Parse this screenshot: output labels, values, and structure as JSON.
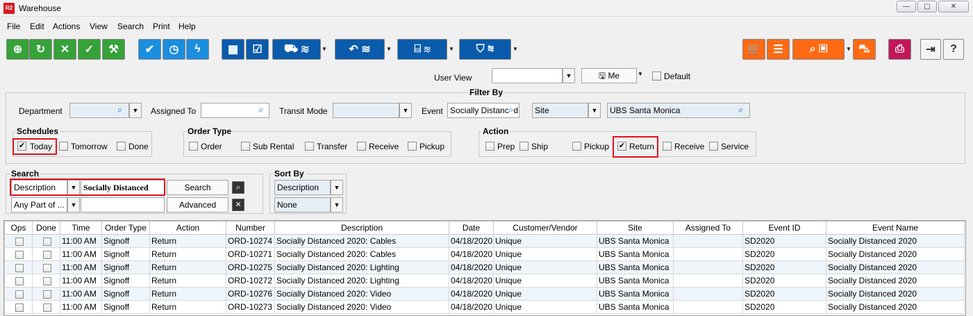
{
  "window": {
    "title": "Warehouse",
    "logo": "R2"
  },
  "menu": [
    "File",
    "Edit",
    "Actions",
    "View",
    "Search",
    "Print",
    "Help"
  ],
  "toolbar_icons": {
    "group1": [
      "add-document-icon",
      "refresh-icon",
      "close-icon",
      "checkmark-icon",
      "hand-truck-icon"
    ],
    "group2": [
      "check-circle-icon",
      "clock-icon",
      "lightning-icon"
    ],
    "group3": [
      "calendar-edit-icon",
      "checkbox-icon",
      "truck-stack-icon",
      "return-stack-icon",
      "door-stack-icon",
      "bucket-stack-icon"
    ],
    "group4": [
      "cart-icon",
      "user-report-icon",
      "search-box-icon",
      "vehicle-icon",
      "printer-icon",
      "exit-icon"
    ],
    "help_label": "?"
  },
  "user_view": {
    "label": "User View",
    "value": "",
    "me_label": "Me",
    "default_label": "Default"
  },
  "filter": {
    "title": "Filter By",
    "department_label": "Department",
    "department_value": "",
    "assigned_to_label": "Assigned To",
    "assigned_to_value": "",
    "transit_mode_label": "Transit Mode",
    "transit_mode_value": "",
    "event_label": "Event",
    "event_value": "Socially Distanced",
    "site_select": "Site",
    "site_value": "UBS Santa Monica"
  },
  "schedules": {
    "title": "Schedules",
    "today": "Today",
    "tomorrow": "Tomorrow",
    "done": "Done",
    "today_checked": true
  },
  "order_type": {
    "title": "Order Type",
    "items": [
      "Order",
      "Sub Rental",
      "Transfer",
      "Receive",
      "Pickup"
    ]
  },
  "action": {
    "title": "Action",
    "prep": "Prep",
    "ship": "Ship",
    "pickup": "Pickup",
    "return": "Return",
    "receive": "Receive",
    "service": "Service",
    "return_checked": true
  },
  "search": {
    "title": "Search",
    "field": "Description",
    "match": "Any Part of ...",
    "value": "Socially Distanced",
    "search_btn": "Search",
    "advanced_btn": "Advanced"
  },
  "sort_by": {
    "title": "Sort By",
    "primary": "Description",
    "secondary": "None"
  },
  "grid": {
    "columns": [
      "Ops",
      "Done",
      "Time",
      "Order Type",
      "Action",
      "Number",
      "Description",
      "Date",
      "Customer/Vendor",
      "Site",
      "Assigned To",
      "Event ID",
      "Event Name"
    ],
    "rows": [
      [
        "",
        "",
        "11:00 AM",
        "Signoff",
        "Return",
        "ORD-10274",
        "Socially Distanced 2020: Cables",
        "04/18/2020",
        "Unique",
        "UBS Santa Monica",
        "",
        "SD2020",
        "Socially Distanced 2020"
      ],
      [
        "",
        "",
        "11:00 AM",
        "Signoff",
        "Return",
        "ORD-10271",
        "Socially Distanced 2020: Cables",
        "04/18/2020",
        "Unique",
        "UBS Santa Monica",
        "",
        "SD2020",
        "Socially Distanced 2020"
      ],
      [
        "",
        "",
        "11:00 AM",
        "Signoff",
        "Return",
        "ORD-10275",
        "Socially Distanced 2020: Lighting",
        "04/18/2020",
        "Unique",
        "UBS Santa Monica",
        "",
        "SD2020",
        "Socially Distanced 2020"
      ],
      [
        "",
        "",
        "11:00 AM",
        "Signoff",
        "Return",
        "ORD-10272",
        "Socially Distanced 2020: Lighting",
        "04/18/2020",
        "Unique",
        "UBS Santa Monica",
        "",
        "SD2020",
        "Socially Distanced 2020"
      ],
      [
        "",
        "",
        "11:00 AM",
        "Signoff",
        "Return",
        "ORD-10276",
        "Socially Distanced 2020: Video",
        "04/18/2020",
        "Unique",
        "UBS Santa Monica",
        "",
        "SD2020",
        "Socially Distanced 2020"
      ],
      [
        "",
        "",
        "11:00 AM",
        "Signoff",
        "Return",
        "ORD-10273",
        "Socially Distanced 2020: Video",
        "04/18/2020",
        "Unique",
        "UBS Santa Monica",
        "",
        "SD2020",
        "Socially Distanced 2020"
      ]
    ]
  },
  "colors": {
    "green": "#36a23a",
    "blue": "#1b8ee0",
    "dark_blue": "#0a5bab",
    "orange": "#ff6a13",
    "crimson": "#c2185b",
    "highlight_red": "#e0131a"
  }
}
